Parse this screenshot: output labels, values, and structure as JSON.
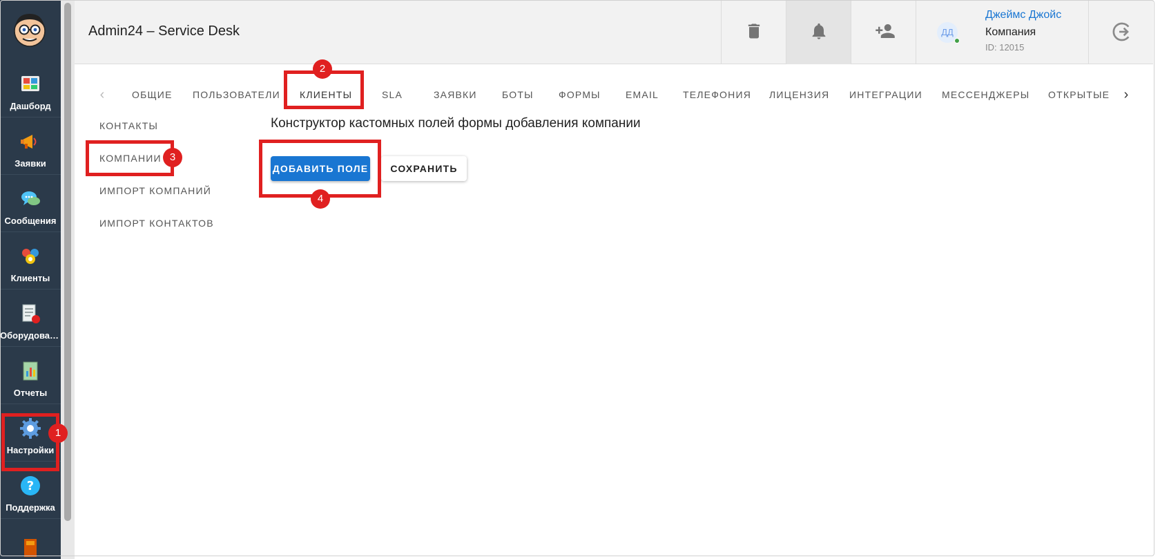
{
  "app": {
    "title": "Admin24 – Service Desk"
  },
  "nav": {
    "items": [
      {
        "label": "Дашборд",
        "icon": "dashboard-icon"
      },
      {
        "label": "Заявки",
        "icon": "megaphone-icon"
      },
      {
        "label": "Сообщения",
        "icon": "chat-icon"
      },
      {
        "label": "Клиенты",
        "icon": "clients-icon"
      },
      {
        "label": "Оборудован…",
        "icon": "equipment-icon"
      },
      {
        "label": "Отчеты",
        "icon": "reports-icon"
      },
      {
        "label": "Настройки",
        "icon": "settings-gear-icon"
      },
      {
        "label": "Поддержка",
        "icon": "help-icon"
      }
    ]
  },
  "header": {
    "user": {
      "initials": "ДД",
      "name": "Джеймс Джойс",
      "company": "Компания",
      "id": "ID: 12015"
    }
  },
  "tabs": [
    "ОБЩИЕ",
    "ПОЛЬЗОВАТЕЛИ",
    "КЛИЕНТЫ",
    "SLA",
    "ЗАЯВКИ",
    "БОТЫ",
    "ФОРМЫ",
    "EMAIL",
    "ТЕЛЕФОНИЯ",
    "ЛИЦЕНЗИЯ",
    "ИНТЕГРАЦИИ",
    "МЕССЕНДЖЕРЫ",
    "ОТКРЫТЫЕ"
  ],
  "submenu": [
    "КОНТАКТЫ",
    "КОМПАНИИ",
    "ИМПОРТ КОМПАНИЙ",
    "ИМПОРТ КОНТАКТОВ"
  ],
  "content": {
    "title": "Конструктор кастомных полей формы добавления компании",
    "add_button": "ДОБАВИТЬ ПОЛЕ",
    "save_button": "СОХРАНИТЬ"
  },
  "annotations": [
    "1",
    "2",
    "3",
    "4"
  ],
  "colors": {
    "nav_bg": "#2b3a4a",
    "accent": "#1976d2",
    "annotation": "#e02020"
  }
}
